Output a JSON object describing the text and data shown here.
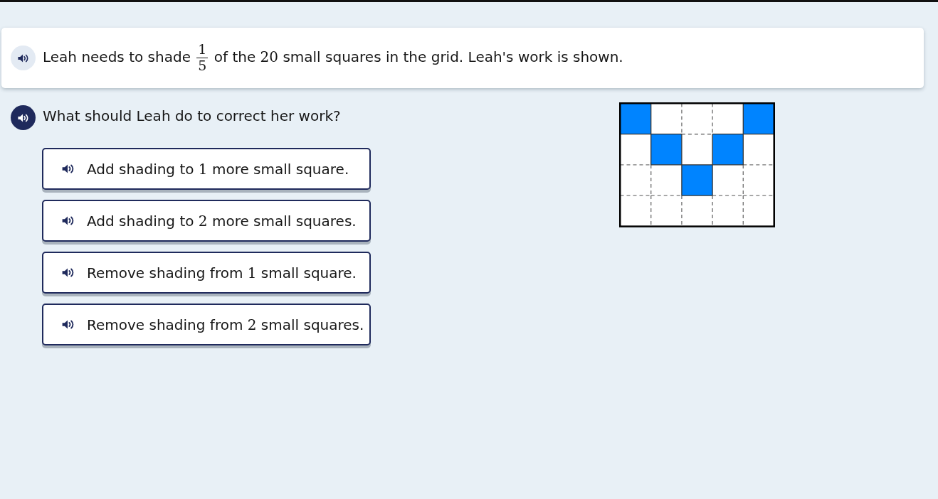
{
  "prompt": {
    "segments": [
      {
        "kind": "text",
        "text": "Leah needs to shade"
      },
      {
        "kind": "fraction",
        "numerator": "1",
        "denominator": "5"
      },
      {
        "kind": "text",
        "text": "of the"
      },
      {
        "kind": "number",
        "text": "20"
      },
      {
        "kind": "text",
        "text": "small squares in the grid. Leah's work is shown."
      }
    ]
  },
  "question": {
    "text": "What should Leah do to correct her work?"
  },
  "options": [
    {
      "selected": false,
      "segments": [
        {
          "kind": "text",
          "text": "Add shading to"
        },
        {
          "kind": "number",
          "text": "1"
        },
        {
          "kind": "text",
          "text": "more small square."
        }
      ]
    },
    {
      "selected": false,
      "segments": [
        {
          "kind": "text",
          "text": "Add shading to"
        },
        {
          "kind": "number",
          "text": "2"
        },
        {
          "kind": "text",
          "text": "more small squares."
        }
      ]
    },
    {
      "selected": false,
      "segments": [
        {
          "kind": "text",
          "text": "Remove shading from"
        },
        {
          "kind": "number",
          "text": "1"
        },
        {
          "kind": "text",
          "text": "small square."
        }
      ]
    },
    {
      "selected": false,
      "segments": [
        {
          "kind": "text",
          "text": "Remove shading from"
        },
        {
          "kind": "number",
          "text": "2"
        },
        {
          "kind": "text",
          "text": "small squares."
        }
      ]
    }
  ],
  "grid": {
    "rows": [
      {
        "cells": [
          {
            "shaded": true
          },
          {
            "shaded": false
          },
          {
            "shaded": false
          },
          {
            "shaded": false
          },
          {
            "shaded": true
          }
        ]
      },
      {
        "cells": [
          {
            "shaded": false
          },
          {
            "shaded": true
          },
          {
            "shaded": false
          },
          {
            "shaded": true
          },
          {
            "shaded": false
          }
        ]
      },
      {
        "cells": [
          {
            "shaded": false
          },
          {
            "shaded": false
          },
          {
            "shaded": true
          },
          {
            "shaded": false
          },
          {
            "shaded": false
          }
        ]
      },
      {
        "cells": [
          {
            "shaded": false
          },
          {
            "shaded": false
          },
          {
            "shaded": false
          },
          {
            "shaded": false
          },
          {
            "shaded": false
          }
        ]
      }
    ]
  }
}
